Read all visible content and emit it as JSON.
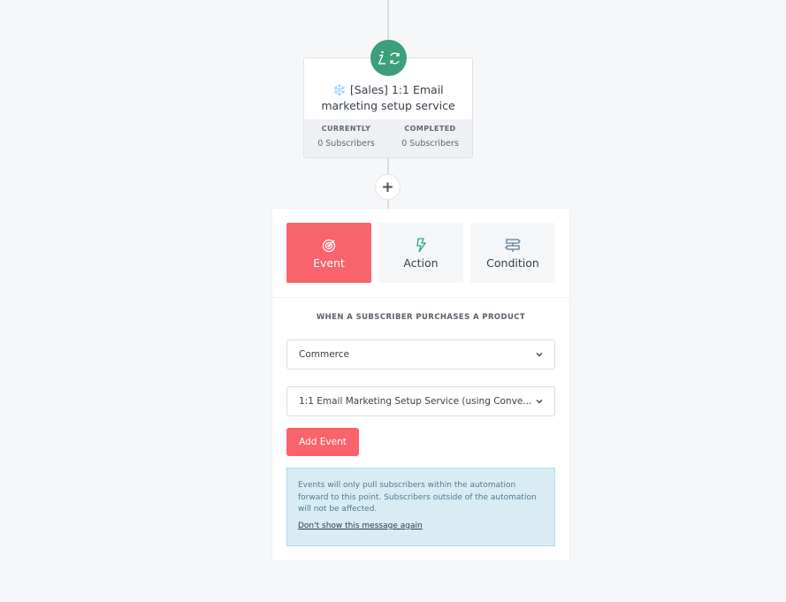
{
  "step_card": {
    "title": "❄️ [Sales] 1:1 Email marketing setup service",
    "stats": [
      {
        "label": "CURRENTLY",
        "value": "0 Subscribers"
      },
      {
        "label": "COMPLETED",
        "value": "0 Subscribers"
      }
    ],
    "badge_icon": "funnel-sync-icon",
    "badge_color": "#3a9f7a"
  },
  "add_step": {
    "label": "+"
  },
  "panel": {
    "tabs": [
      {
        "label": "Event",
        "icon": "target-icon",
        "active": true
      },
      {
        "label": "Action",
        "icon": "lightning-icon",
        "active": false
      },
      {
        "label": "Condition",
        "icon": "signpost-icon",
        "active": false
      }
    ],
    "heading": "WHEN A SUBSCRIBER PURCHASES A PRODUCT",
    "select_category": "Commerce",
    "select_product": "1:1 Email Marketing Setup Service (using Conve...",
    "add_button": "Add Event",
    "info_text": "Events will only pull subscribers within the automation forward to this point. Subscribers outside of the automation will not be affected.",
    "info_link": "Don't show this message again",
    "accent": "#f9636b"
  }
}
